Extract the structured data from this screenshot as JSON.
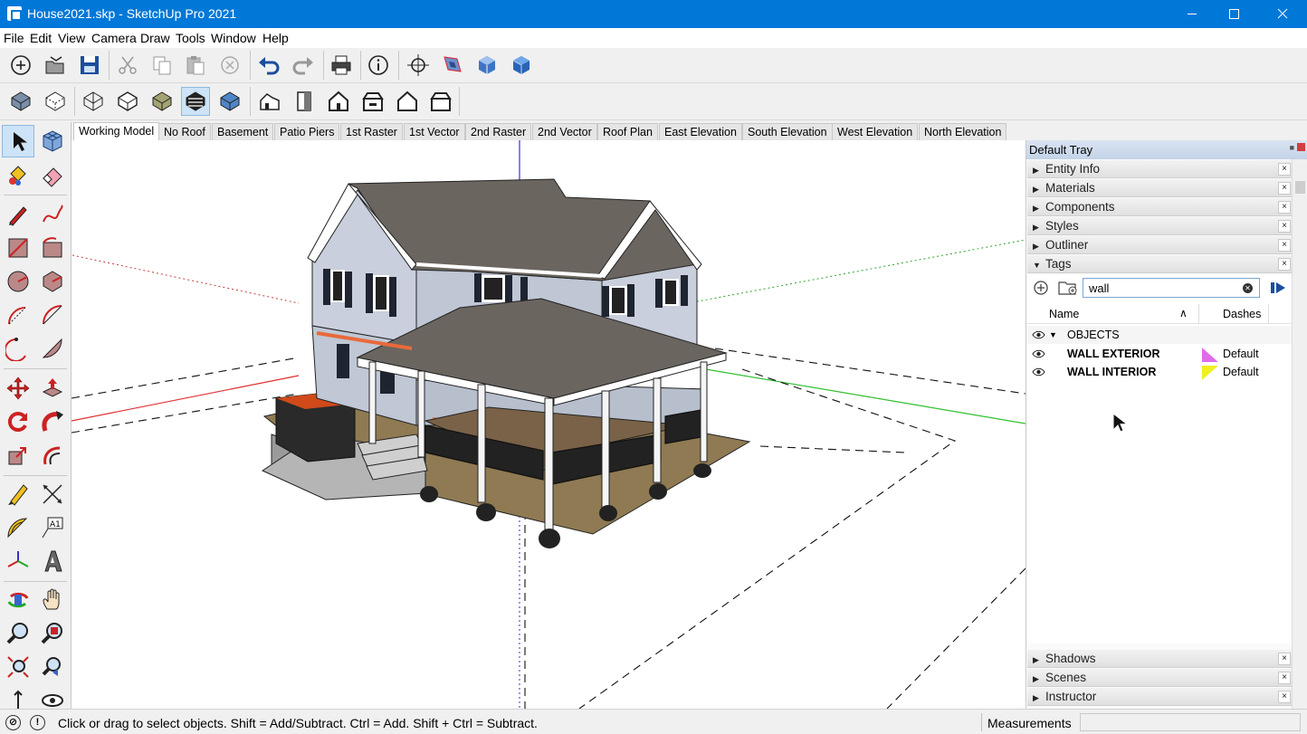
{
  "window": {
    "title": "House2021.skp - SketchUp Pro 2021",
    "controls": {
      "minimize": "—",
      "maximize": "☐",
      "close": "✕"
    }
  },
  "menu": [
    "File",
    "Edit",
    "View",
    "Camera",
    "Draw",
    "Tools",
    "Window",
    "Help"
  ],
  "toolbar_top": [
    "new-icon",
    "open-icon",
    "save-icon",
    "cut-icon",
    "copy-icon",
    "paste-icon",
    "erase-icon",
    "undo-icon",
    "redo-icon",
    "print-icon",
    "model-info-icon",
    "zoom-extents-icon",
    "add-location-icon",
    "preview-location-icon",
    "photo-textures-icon"
  ],
  "toolbar_views": [
    "xray-icon",
    "back-edges-icon",
    "wireframe-icon",
    "hidden-line-icon",
    "shaded-icon",
    "shaded-textures-icon",
    "monochrome-icon",
    "iso-view-icon",
    "top-view-icon",
    "front-view-icon",
    "right-view-icon",
    "back-view-icon",
    "left-view-icon"
  ],
  "left_tools": [
    "select-icon",
    "component-icon",
    "paint-bucket-icon",
    "eraser-icon",
    "line-icon",
    "freehand-icon",
    "rectangle-icon",
    "rotated-rectangle-icon",
    "circle-icon",
    "polygon-icon",
    "arc-icon",
    "two-point-arc-icon",
    "three-point-arc-icon",
    "pie-icon",
    "move-icon",
    "push-pull-icon",
    "rotate-icon",
    "follow-me-icon",
    "scale-icon",
    "offset-icon",
    "tape-measure-icon",
    "dimension-icon",
    "protractor-icon",
    "text-icon",
    "axes-icon",
    "3d-text-icon",
    "orbit-icon",
    "pan-icon",
    "zoom-icon",
    "zoom-window-icon",
    "zoom-extents-icon",
    "previous-view-icon",
    "position-camera-icon",
    "look-around-icon"
  ],
  "scene_tabs": [
    "Working Model",
    "No Roof",
    "Basement",
    "Patio Piers",
    "1st Raster",
    "1st Vector",
    "2nd Raster",
    "2nd Vector",
    "Roof Plan",
    "East Elevation",
    "South Elevation",
    "West Elevation",
    "North Elevation"
  ],
  "active_scene": "Working Model",
  "tray": {
    "title": "Default Tray",
    "panels_top": [
      "Entity Info",
      "Materials",
      "Components",
      "Styles",
      "Outliner",
      "Tags"
    ],
    "panels_bottom": [
      "Shadows",
      "Scenes",
      "Instructor"
    ],
    "close_glyph": "×",
    "tags": {
      "search_value": "wall",
      "col_name": "Name",
      "col_dashes": "Dashes",
      "sort_glyph": "∧",
      "rows": [
        {
          "name": "OBJECTS",
          "folder": true,
          "expander": "▼"
        },
        {
          "name": "WALL EXTERIOR",
          "dashes": "Default",
          "color": "#e06be8"
        },
        {
          "name": "WALL INTERIOR",
          "dashes": "Default",
          "color": "#f0f020"
        }
      ]
    }
  },
  "status": {
    "message": "Click or drag to select objects. Shift = Add/Subtract. Ctrl = Add. Shift + Ctrl = Subtract.",
    "geo_glyph": "⊘",
    "info_glyph": "!",
    "measurements_label": "Measurements",
    "measurements_value": ""
  },
  "colors": {
    "titlebar": "#0078d7",
    "axis_red": "#e03030",
    "axis_green": "#30c030",
    "axis_blue": "#3030d0",
    "siding": "#c9cfdc",
    "roof": "#6b6560"
  }
}
